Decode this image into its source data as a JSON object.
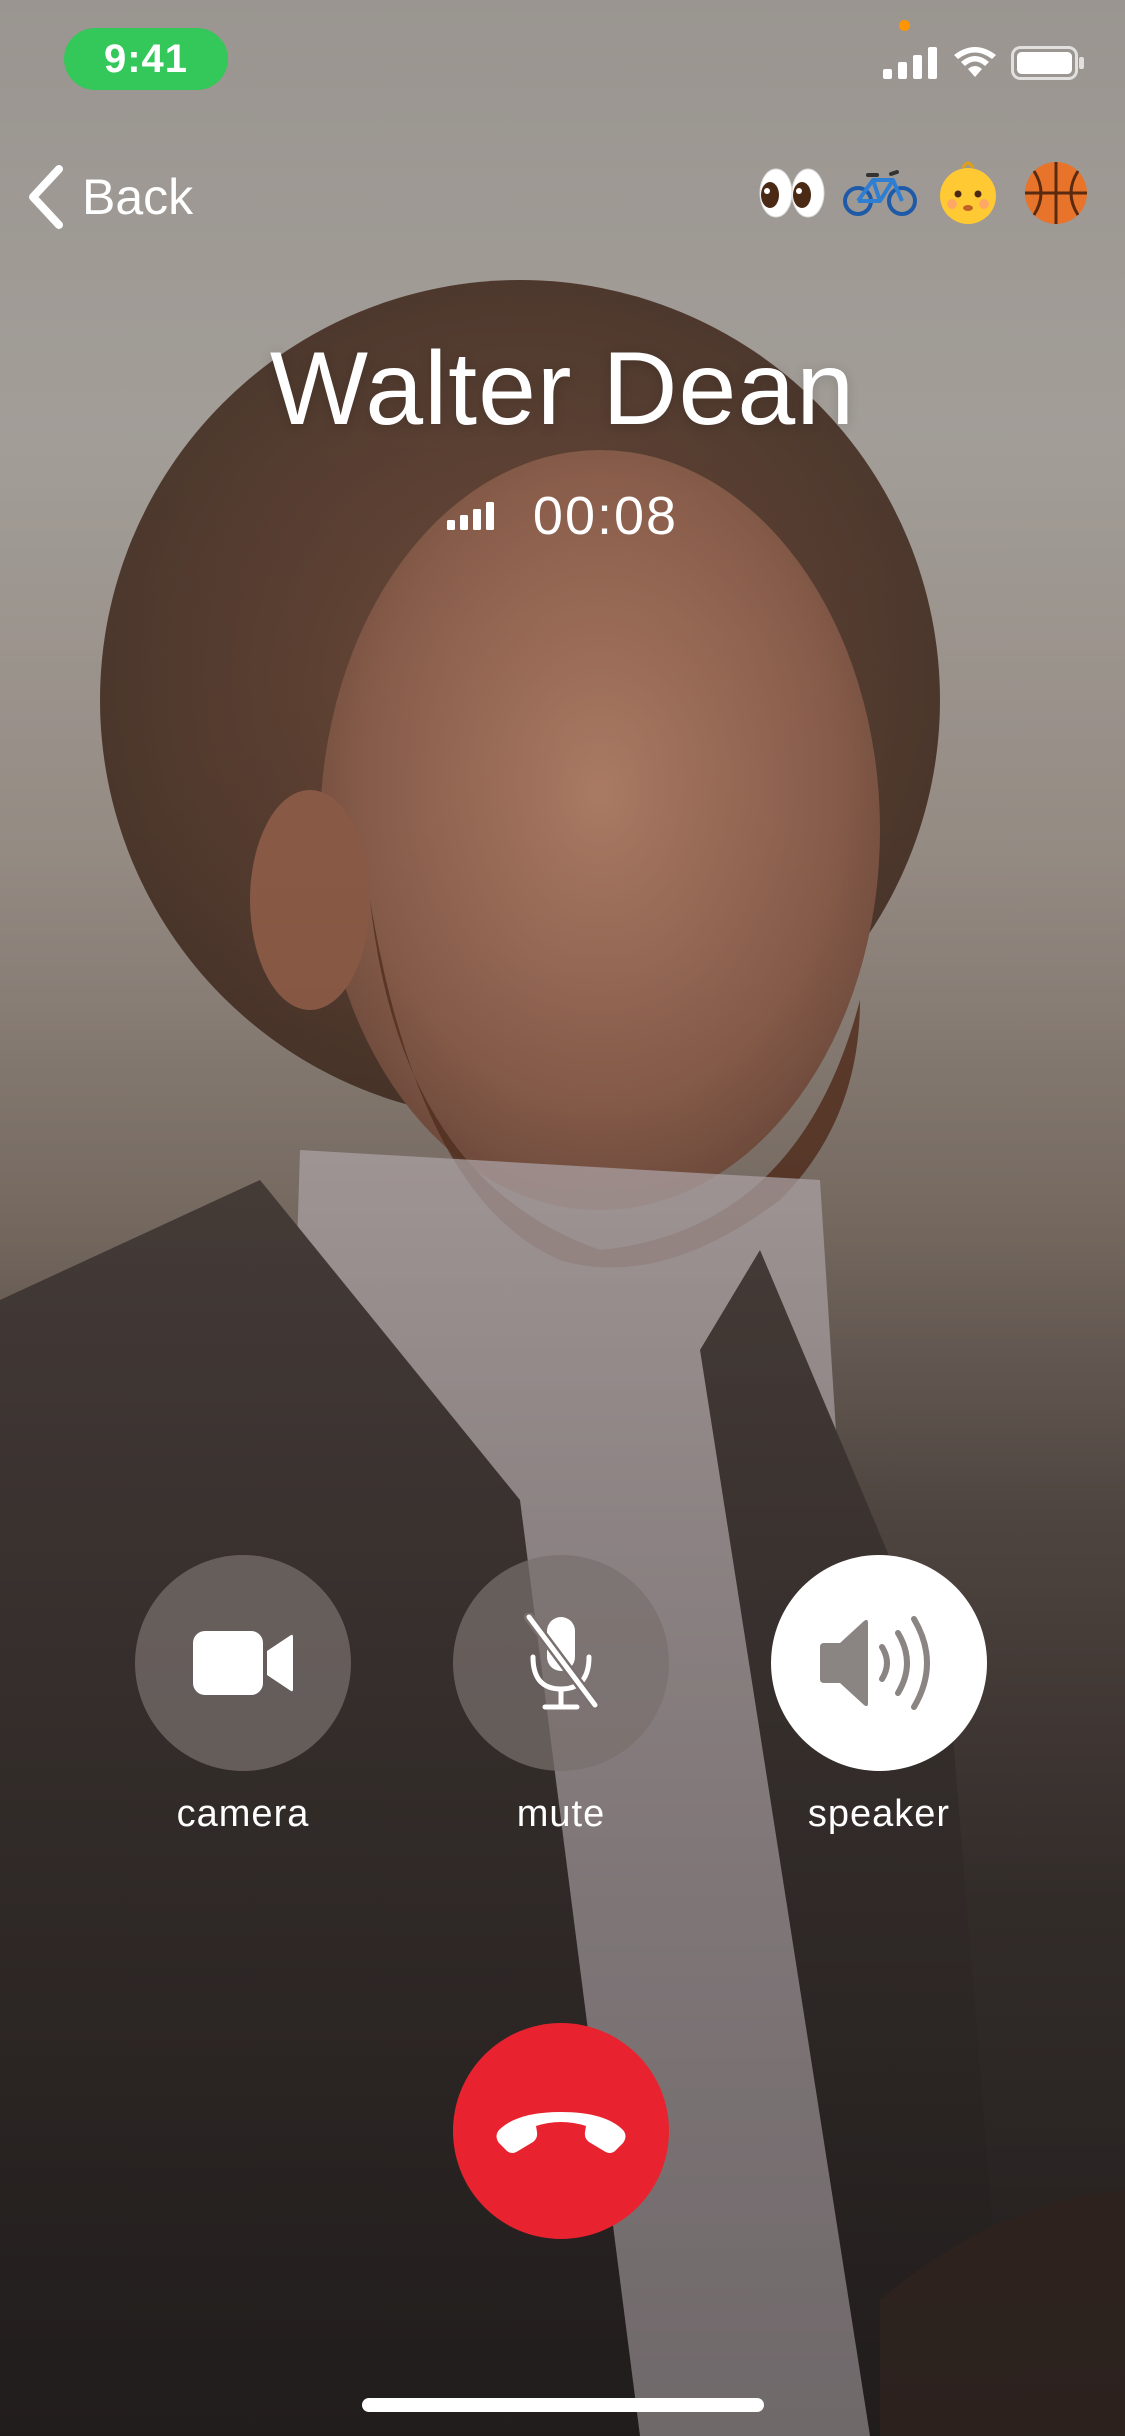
{
  "status_bar": {
    "time": "9:41",
    "icons": [
      "cellular-signal-icon",
      "wifi-icon",
      "battery-icon"
    ],
    "time_pill_color": "#34c759",
    "privacy_dot_color": "#ff9500"
  },
  "nav": {
    "back_label": "Back",
    "reactions": [
      "👀",
      "🚲",
      "👶",
      "🏀"
    ]
  },
  "caller": {
    "name": "Walter Dean",
    "duration": "00:08",
    "signal_icon": "signal-strength-icon"
  },
  "controls": [
    {
      "label": "camera",
      "icon": "video-camera-icon",
      "active": false
    },
    {
      "label": "mute",
      "icon": "microphone-slash-icon",
      "active": false
    },
    {
      "label": "speaker",
      "icon": "speaker-wave-icon",
      "active": true
    }
  ],
  "end_call": {
    "icon": "phone-hangup-icon",
    "color": "#e8232f"
  }
}
